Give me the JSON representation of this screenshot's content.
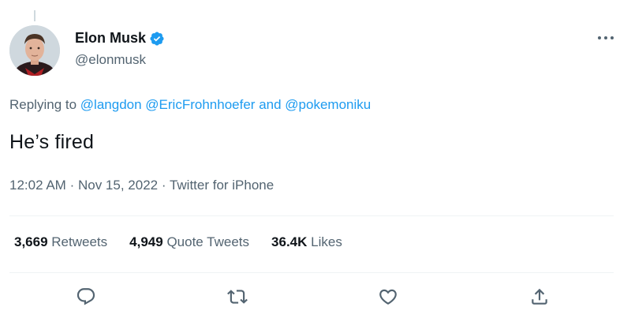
{
  "tweet": {
    "author": {
      "display_name": "Elon Musk",
      "handle": "@elonmusk",
      "verified": true,
      "avatar": "profile-photo"
    },
    "reply_to": {
      "prefix": "Replying to",
      "mention_1": "@langdon",
      "mention_2": "@EricFrohnhoefer",
      "conjunction": "and",
      "mention_3": "@pokemoniku"
    },
    "text": "He’s fired",
    "time": "12:02 AM",
    "separator": "·",
    "date": "Nov 15, 2022",
    "source": "Twitter for iPhone",
    "stats": [
      {
        "count": "3,669",
        "label": "Retweets"
      },
      {
        "count": "4,949",
        "label": "Quote Tweets"
      },
      {
        "count": "36.4K",
        "label": "Likes"
      }
    ]
  },
  "icons": {
    "verified": "verified-badge-icon",
    "more": "more-dots-icon",
    "reply": "reply-icon",
    "retweet": "retweet-icon",
    "like": "heart-icon",
    "share": "share-icon"
  },
  "colors": {
    "accent": "#1d9bf0",
    "text_primary": "#0f1419",
    "text_secondary": "#536471",
    "divider": "#eff3f4"
  }
}
